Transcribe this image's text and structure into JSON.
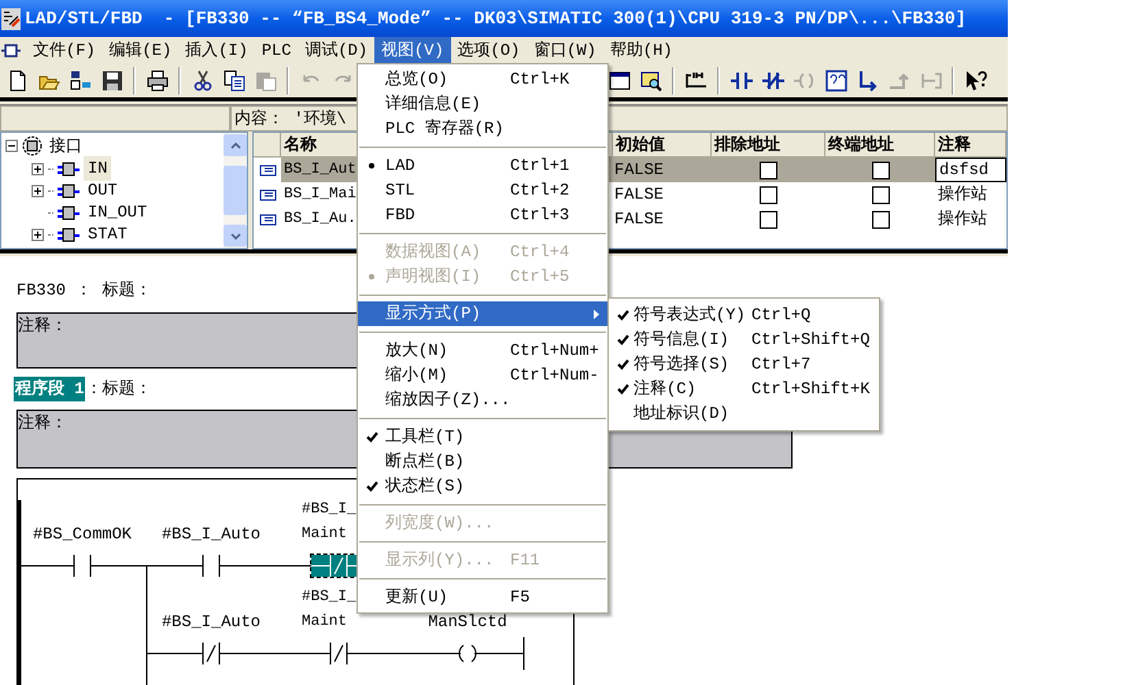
{
  "window": {
    "title": "LAD/STL/FBD  - [FB330 -- “FB_BS4_Mode” -- DK03\\SIMATIC 300(1)\\CPU 319-3 PN/DP\\...\\FB330]"
  },
  "menu_bar": [
    {
      "label": "文件(F)",
      "selected": false
    },
    {
      "label": "编辑(E)",
      "selected": false
    },
    {
      "label": "插入(I)",
      "selected": false
    },
    {
      "label": "PLC",
      "selected": false
    },
    {
      "label": "调试(D)",
      "selected": false
    },
    {
      "label": "视图(V)",
      "selected": true
    },
    {
      "label": "选项(O)",
      "selected": false
    },
    {
      "label": "窗口(W)",
      "selected": false
    },
    {
      "label": "帮助(H)",
      "selected": false
    }
  ],
  "toolbar_left": [
    {
      "kind": "new",
      "disabled": false
    },
    {
      "kind": "open",
      "disabled": false
    },
    {
      "kind": "download",
      "disabled": false
    },
    {
      "kind": "save",
      "disabled": false
    },
    {
      "kind": "sep"
    },
    {
      "kind": "print",
      "disabled": false
    },
    {
      "kind": "sep"
    },
    {
      "kind": "cut",
      "disabled": false
    },
    {
      "kind": "copy",
      "disabled": false
    },
    {
      "kind": "paste",
      "disabled": true
    },
    {
      "kind": "sep"
    },
    {
      "kind": "undo",
      "disabled": true
    },
    {
      "kind": "redo",
      "disabled": true
    }
  ],
  "toolbar_right": [
    {
      "kind": "window",
      "disabled": false
    },
    {
      "kind": "zoom",
      "disabled": false
    },
    {
      "kind": "sep"
    },
    {
      "kind": "network",
      "disabled": false
    },
    {
      "kind": "sep"
    },
    {
      "kind": "contact_no",
      "disabled": false
    },
    {
      "kind": "contact_nc",
      "disabled": false
    },
    {
      "kind": "coil",
      "disabled": true
    },
    {
      "kind": "box",
      "disabled": false
    },
    {
      "kind": "branch_open",
      "disabled": false
    },
    {
      "kind": "branch_close",
      "disabled": true
    },
    {
      "kind": "connection",
      "disabled": true
    },
    {
      "kind": "sep"
    },
    {
      "kind": "help",
      "disabled": false
    }
  ],
  "content_path": "内容： '环境\\",
  "tree": [
    {
      "label": "接口",
      "expanded": true,
      "selected": false,
      "children": [
        {
          "label": "IN",
          "expanded": false,
          "selected": true
        },
        {
          "label": "OUT",
          "expanded": false,
          "selected": false
        },
        {
          "label": "IN_OUT",
          "selected": false
        },
        {
          "label": "STAT",
          "expanded": false,
          "selected": false
        }
      ]
    }
  ],
  "table": {
    "columns": [
      "名称",
      "初始值",
      "排除地址",
      "终端地址",
      "注释"
    ],
    "rows": [
      {
        "name": "BS_I_Aut",
        "initial": "FALSE",
        "exclude_address": false,
        "terminal_address": false,
        "comment": "dsfsd",
        "selected": true
      },
      {
        "name": "BS_I_Mai",
        "initial": "FALSE",
        "exclude_address": false,
        "terminal_address": false,
        "comment": "操作站",
        "selected": false
      },
      {
        "name": "BS_I_Au.",
        "initial": "FALSE",
        "exclude_address": false,
        "terminal_address": false,
        "comment": "操作站",
        "selected": false
      }
    ]
  },
  "editor": {
    "block_title": "FB330 ： 标题：",
    "block_comment": "注释：",
    "network": {
      "label": "程序段 1",
      "title": "：标题：",
      "comment": "注释：",
      "rungs": [
        {
          "elements": [
            {
              "kind": "contact_no",
              "operand": [
                "#BS_CommOK"
              ],
              "selected": false
            },
            {
              "kind": "contact_no",
              "operand": [
                "#BS_I_Auto"
              ],
              "selected": false
            },
            {
              "kind": "contact_nc",
              "operand": [
                "#BS_I_",
                "Maint"
              ],
              "selected": true
            }
          ]
        },
        {
          "elements": [
            {
              "kind": "contact_nc",
              "operand": [
                "#BS_I_Auto"
              ],
              "selected": false
            },
            {
              "kind": "contact_nc",
              "operand": [
                "#BS_I_",
                "Maint"
              ],
              "selected": false
            },
            {
              "kind": "coil",
              "operand": [
                "ManSlctd"
              ],
              "selected": false
            }
          ]
        }
      ]
    }
  },
  "view_menu": [
    {
      "kind": "item",
      "label": "总览(O)",
      "shortcut": "Ctrl+K",
      "checked": false,
      "radio": false,
      "disabled": false,
      "selected": false
    },
    {
      "kind": "item",
      "label": "详细信息(E)",
      "checked": false,
      "radio": false,
      "disabled": false,
      "selected": false
    },
    {
      "kind": "item",
      "label": "PLC 寄存器(R)",
      "checked": false,
      "radio": false,
      "disabled": false,
      "selected": false
    },
    {
      "kind": "separator"
    },
    {
      "kind": "item",
      "label": "LAD",
      "shortcut": "Ctrl+1",
      "checked": false,
      "radio": true,
      "disabled": false,
      "selected": false
    },
    {
      "kind": "item",
      "label": "STL",
      "shortcut": "Ctrl+2",
      "checked": false,
      "radio": false,
      "disabled": false,
      "selected": false
    },
    {
      "kind": "item",
      "label": "FBD",
      "shortcut": "Ctrl+3",
      "checked": false,
      "radio": false,
      "disabled": false,
      "selected": false
    },
    {
      "kind": "separator"
    },
    {
      "kind": "item",
      "label": "数据视图(A)",
      "shortcut": "Ctrl+4",
      "checked": false,
      "radio": false,
      "disabled": true,
      "selected": false
    },
    {
      "kind": "item",
      "label": "声明视图(I)",
      "shortcut": "Ctrl+5",
      "checked": false,
      "radio": true,
      "disabled": true,
      "selected": false
    },
    {
      "kind": "separator"
    },
    {
      "kind": "item",
      "label": "显示方式(P)",
      "checked": false,
      "radio": false,
      "disabled": false,
      "selected": true,
      "submenu": true
    },
    {
      "kind": "separator"
    },
    {
      "kind": "item",
      "label": "放大(N)",
      "shortcut": "Ctrl+Num+",
      "checked": false,
      "radio": false,
      "disabled": false,
      "selected": false
    },
    {
      "kind": "item",
      "label": "缩小(M)",
      "shortcut": "Ctrl+Num-",
      "checked": false,
      "radio": false,
      "disabled": false,
      "selected": false
    },
    {
      "kind": "item",
      "label": "缩放因子(Z)...",
      "checked": false,
      "radio": false,
      "disabled": false,
      "selected": false
    },
    {
      "kind": "separator"
    },
    {
      "kind": "item",
      "label": "工具栏(T)",
      "checked": true,
      "radio": false,
      "disabled": false,
      "selected": false
    },
    {
      "kind": "item",
      "label": "断点栏(B)",
      "checked": false,
      "radio": false,
      "disabled": false,
      "selected": false
    },
    {
      "kind": "item",
      "label": "状态栏(S)",
      "checked": true,
      "radio": false,
      "disabled": false,
      "selected": false
    },
    {
      "kind": "separator"
    },
    {
      "kind": "item",
      "label": "列宽度(W)...",
      "checked": false,
      "radio": false,
      "disabled": true,
      "selected": false
    },
    {
      "kind": "separator"
    },
    {
      "kind": "item",
      "label": "显示列(Y)...",
      "shortcut": "F11",
      "checked": false,
      "radio": false,
      "disabled": true,
      "selected": false
    },
    {
      "kind": "separator"
    },
    {
      "kind": "item",
      "label": "更新(U)",
      "shortcut": "F5",
      "checked": false,
      "radio": false,
      "disabled": false,
      "selected": false
    }
  ],
  "display_submenu": [
    {
      "label": "符号表达式(Y)",
      "shortcut": "Ctrl+Q",
      "checked": true
    },
    {
      "label": "符号信息(I)",
      "shortcut": "Ctrl+Shift+Q",
      "checked": true
    },
    {
      "label": "符号选择(S)",
      "shortcut": "Ctrl+7",
      "checked": true
    },
    {
      "label": "注释(C)",
      "shortcut": "Ctrl+Shift+K",
      "checked": true
    },
    {
      "label": "地址标识(D)",
      "checked": false
    }
  ]
}
